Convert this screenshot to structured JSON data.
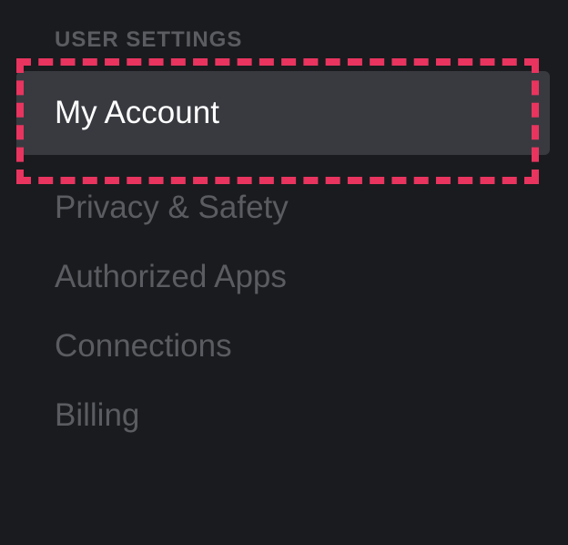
{
  "sidebar": {
    "section_header": "USER SETTINGS",
    "items": [
      {
        "label": "My Account",
        "selected": true
      },
      {
        "label": "Privacy & Safety",
        "selected": false
      },
      {
        "label": "Authorized Apps",
        "selected": false
      },
      {
        "label": "Connections",
        "selected": false
      },
      {
        "label": "Billing",
        "selected": false
      }
    ]
  },
  "highlight": {
    "color": "#e8345f"
  }
}
